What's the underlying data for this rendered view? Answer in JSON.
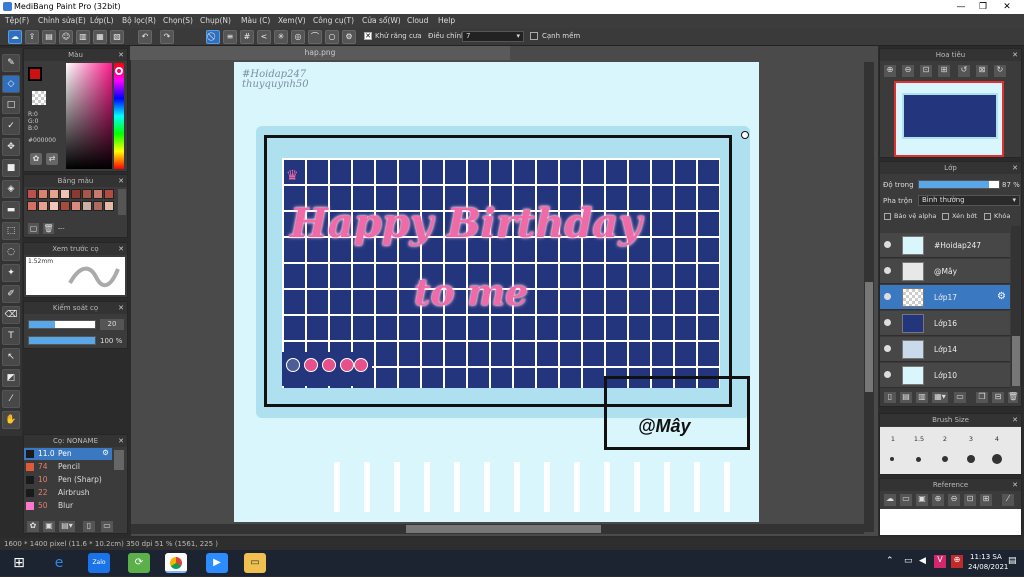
{
  "window": {
    "title": "MediBang Paint Pro (32bit)",
    "minimize": "—",
    "restore": "❐",
    "close": "✕"
  },
  "menu": [
    "Tệp(F)",
    "Chỉnh sửa(E)",
    "Lớp(L)",
    "Bộ lọc(R)",
    "Chọn(S)",
    "Chụp(N)",
    "Màu (C)",
    "Xem(V)",
    "Công cụ(T)",
    "Cửa sổ(W)",
    "Cloud",
    "Help"
  ],
  "toolbar": {
    "antialias_label": "Khử răng cưa",
    "adjust_label": "Điều chỉnh",
    "adjust_value": "7",
    "soft_edge_label": "Cạnh mềm"
  },
  "color_panel": {
    "title": "Màu",
    "r": "R:0",
    "g": "G:0",
    "b": "B:0",
    "hex": "#000000",
    "primary_color": "#cc1111"
  },
  "palette_panel": {
    "title": "Bảng màu",
    "dash": "---",
    "colors": [
      "#c0504d",
      "#d9826e",
      "#e8a38f",
      "#f0c2b4",
      "#8b3a2f",
      "#a8564a",
      "#c87b6c",
      "#b24c3f",
      "#d47062",
      "#e7a090",
      "#f2c6b8",
      "#a84a3e",
      "#dc8a79",
      "#c9b1a5",
      "#ad6b5f",
      "#e6b8a6"
    ]
  },
  "brush_preview": {
    "title": "Xem trước cọ",
    "size": "1.52mm"
  },
  "brush_control": {
    "title": "Kiểm soát cọ",
    "size_value": "20",
    "opacity_value": "100 %"
  },
  "brush_list": {
    "title": "Cọ: NONAME",
    "items": [
      {
        "size": "11.0",
        "name": "Pen",
        "color": "#1a1a1a",
        "selected": true
      },
      {
        "size": "74",
        "name": "Pencil",
        "color": "#e05a3a",
        "selected": false
      },
      {
        "size": "10",
        "name": "Pen (Sharp)",
        "color": "#1a1a1a",
        "selected": false
      },
      {
        "size": "22",
        "name": "Airbrush",
        "color": "#1a1a1a",
        "selected": false
      },
      {
        "size": "50",
        "name": "Blur",
        "color": "#ff77cc",
        "selected": false
      }
    ]
  },
  "document": {
    "tab": "hap.png",
    "watermark_tag": "#Hoidap247",
    "watermark_user": "thuyquynh50",
    "art_line1": "Happy Birthday",
    "art_line2": "to me",
    "signature": "@Mây"
  },
  "navigator": {
    "title": "Hoa tiêu"
  },
  "layer_panel": {
    "title": "Lớp",
    "opacity_label": "Độ trong",
    "opacity_value": "87 %",
    "opacity": 0.87,
    "blend_label": "Pha trộn",
    "blend_value": "Bình thường",
    "protect_alpha": "Bảo vệ alpha",
    "clipping": "Xén bớt",
    "lock": "Khóa",
    "layers": [
      {
        "name": "#Hoidap247",
        "selected": false
      },
      {
        "name": "@Mây",
        "selected": false
      },
      {
        "name": "Lớp17",
        "selected": true
      },
      {
        "name": "Lớp16",
        "selected": false
      },
      {
        "name": "Lớp14",
        "selected": false
      },
      {
        "name": "Lớp10",
        "selected": false
      }
    ]
  },
  "brush_size_panel": {
    "title": "Brush Size",
    "sizes": [
      "1",
      "1.5",
      "2",
      "3",
      "4"
    ]
  },
  "reference_panel": {
    "title": "Reference"
  },
  "status": {
    "dimensions": "1600 * 1400 pixel  (11.6 * 10.2cm)  350 dpi  51 %  (1561, 225 )"
  },
  "taskbar": {
    "time": "11:13 SA",
    "date": "24/08/2021",
    "zalo": "Zalo"
  }
}
